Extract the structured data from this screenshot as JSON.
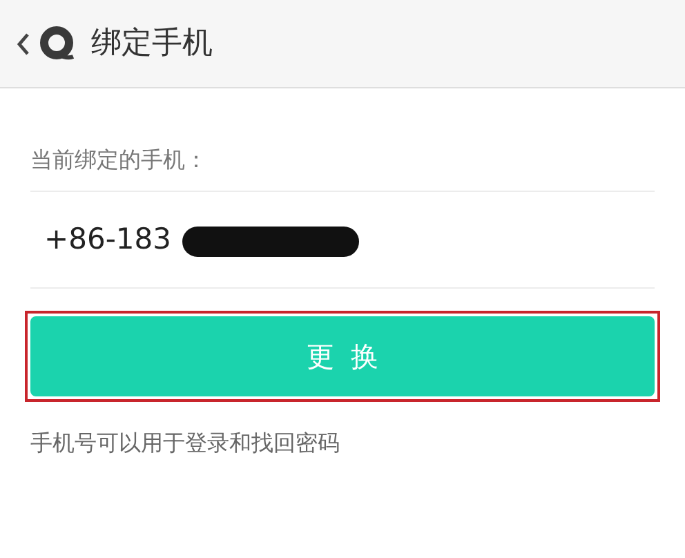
{
  "header": {
    "title": "绑定手机"
  },
  "current_phone": {
    "label": "当前绑定的手机：",
    "value": "+86-183"
  },
  "change_button": {
    "label": "更换",
    "highlighted": true
  },
  "hint": "手机号可以用于登录和找回密码"
}
